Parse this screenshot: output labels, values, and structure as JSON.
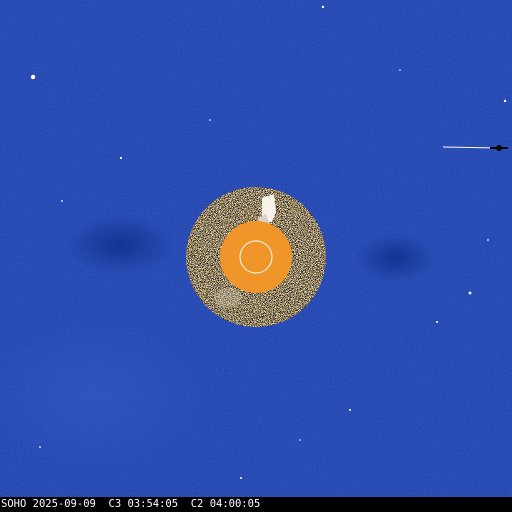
{
  "image": {
    "observatory": "SOHO",
    "date": "2025-09-09",
    "c3_label": "C3",
    "c3_time": "03:54:05",
    "c2_label": "C2",
    "c2_time": "04:00:05"
  },
  "colors": {
    "c3_field": "#1a3fae",
    "c2_ring_dark": "#2a1c10",
    "c2_ring_light": "#e8dcc8",
    "occulter": "#f0952a",
    "sun_outline": "#ffffff",
    "caption_bg": "#000000",
    "caption_text": "#ffffff"
  }
}
